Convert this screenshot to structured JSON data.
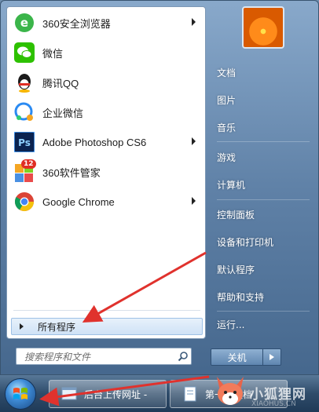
{
  "programs": [
    {
      "label": "360安全浏览器",
      "has_submenu": true,
      "icon": "360-browser-icon"
    },
    {
      "label": "微信",
      "has_submenu": false,
      "icon": "wechat-icon"
    },
    {
      "label": "腾讯QQ",
      "has_submenu": false,
      "icon": "qq-icon"
    },
    {
      "label": "企业微信",
      "has_submenu": false,
      "icon": "wecom-icon"
    },
    {
      "label": "Adobe Photoshop CS6",
      "has_submenu": true,
      "icon": "photoshop-icon"
    },
    {
      "label": "360软件管家",
      "has_submenu": false,
      "icon": "360-software-manager-icon",
      "badge": "12"
    },
    {
      "label": "Google Chrome",
      "has_submenu": true,
      "icon": "chrome-icon"
    }
  ],
  "all_programs_label": "所有程序",
  "search": {
    "placeholder": "搜索程序和文件"
  },
  "right_items": [
    {
      "label": "文档"
    },
    {
      "label": "图片"
    },
    {
      "label": "音乐"
    },
    {
      "label": "游戏"
    },
    {
      "label": "计算机"
    },
    {
      "label": "控制面板"
    },
    {
      "label": "设备和打印机"
    },
    {
      "label": "默认程序"
    },
    {
      "label": "帮助和支持"
    },
    {
      "label": "运行..."
    }
  ],
  "shutdown_label": "关机",
  "taskbar": {
    "items": [
      {
        "label": "后台上传网址 -"
      },
      {
        "label": "第一个文档"
      }
    ]
  },
  "watermark": {
    "text": "小狐狸网",
    "sub": "XIAOHUS.CN"
  },
  "colors": {
    "annotation_arrow": "#e0322d",
    "all_programs_highlight": "#cfe2f6"
  }
}
